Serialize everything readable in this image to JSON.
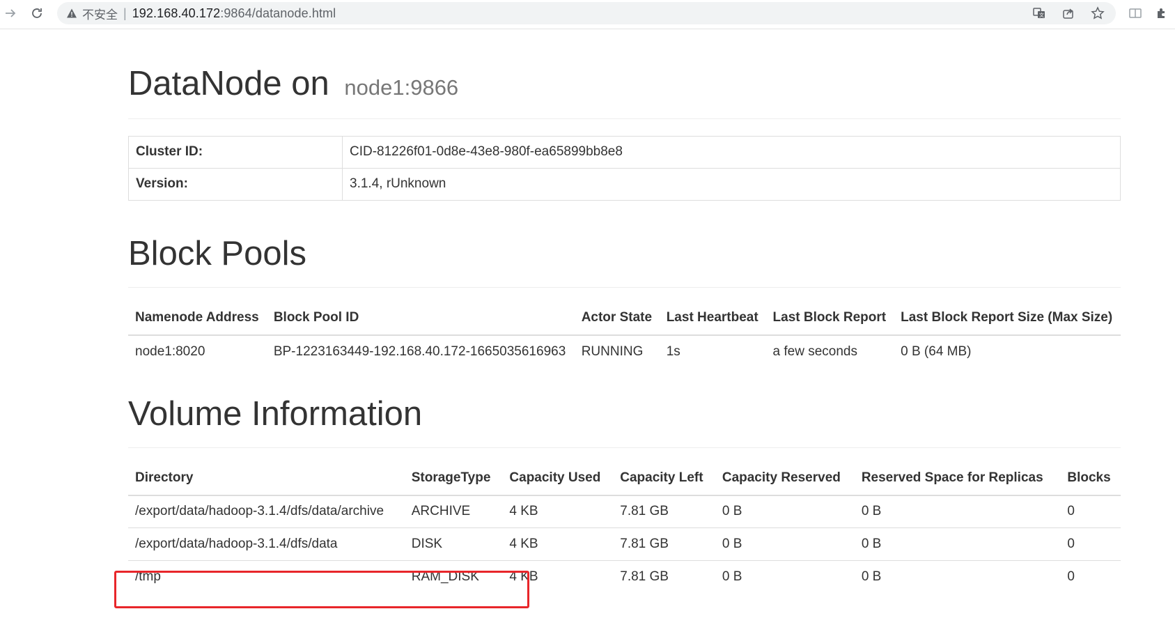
{
  "browser": {
    "security_label": "不安全",
    "url_host": "192.168.40.172",
    "url_path": ":9864/datanode.html"
  },
  "page": {
    "title": "DataNode on",
    "host": "node1:9866"
  },
  "info": {
    "rows": [
      {
        "key": "Cluster ID:",
        "value": "CID-81226f01-0d8e-43e8-980f-ea65899bb8e8"
      },
      {
        "key": "Version:",
        "value": "3.1.4, rUnknown"
      }
    ]
  },
  "block_pools": {
    "heading": "Block Pools",
    "headers": [
      "Namenode Address",
      "Block Pool ID",
      "Actor State",
      "Last Heartbeat",
      "Last Block Report",
      "Last Block Report Size (Max Size)"
    ],
    "rows": [
      [
        "node1:8020",
        "BP-1223163449-192.168.40.172-1665035616963",
        "RUNNING",
        "1s",
        "a few seconds",
        "0 B (64 MB)"
      ]
    ]
  },
  "volumes": {
    "heading": "Volume Information",
    "headers": [
      "Directory",
      "StorageType",
      "Capacity Used",
      "Capacity Left",
      "Capacity Reserved",
      "Reserved Space for Replicas",
      "Blocks"
    ],
    "rows": [
      [
        "/export/data/hadoop-3.1.4/dfs/data/archive",
        "ARCHIVE",
        "4 KB",
        "7.81 GB",
        "0 B",
        "0 B",
        "0"
      ],
      [
        "/export/data/hadoop-3.1.4/dfs/data",
        "DISK",
        "4 KB",
        "7.81 GB",
        "0 B",
        "0 B",
        "0"
      ],
      [
        "/tmp",
        "RAM_DISK",
        "4 KB",
        "7.81 GB",
        "0 B",
        "0 B",
        "0"
      ]
    ]
  },
  "colors": {
    "highlight": "#e8262a",
    "text": "#333333",
    "muted": "#777777"
  }
}
